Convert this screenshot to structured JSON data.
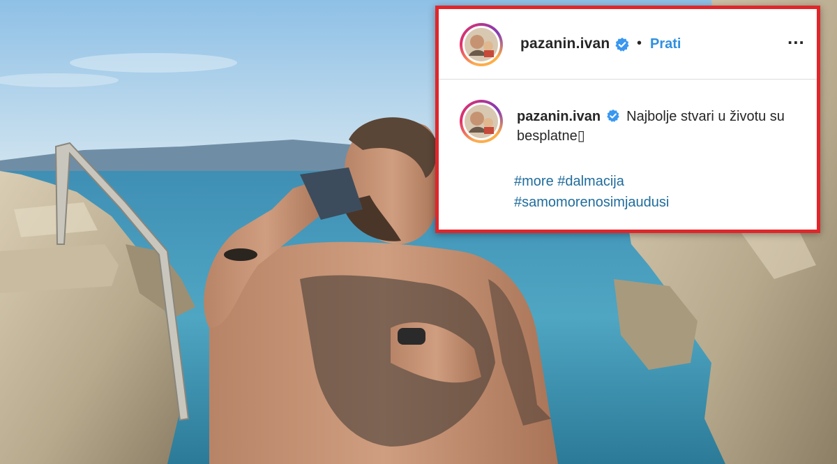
{
  "post": {
    "username": "pazanin.ivan",
    "follow_label": "Prati",
    "separator": "•",
    "more_label": "...",
    "caption_text": "Najbolje stvari u životu su besplatne▯",
    "hashtags": [
      "#more #dalmacija",
      "#samomorenosimjaudusi"
    ]
  },
  "colors": {
    "frame_border": "#e0262b",
    "follow_blue": "#2f8fe0",
    "hashtag_blue": "#1f6c9c",
    "verified_blue": "#3897f0"
  }
}
